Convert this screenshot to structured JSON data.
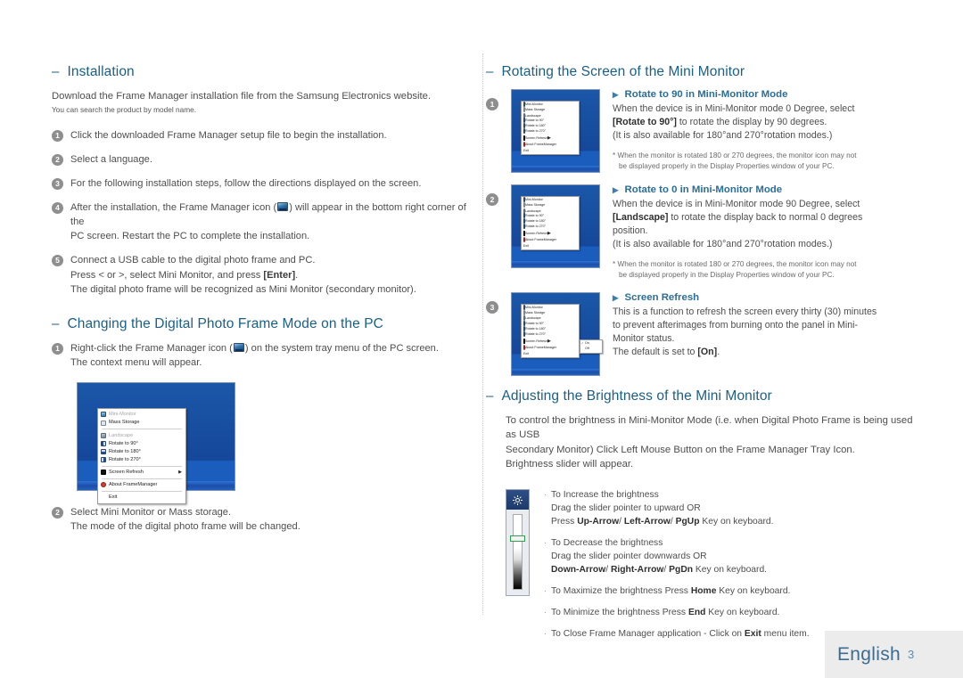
{
  "left": {
    "section1": {
      "heading": "Installation",
      "intro": "Download the Frame Manager installation file from the Samsung Electronics website.",
      "intro_small": "You can search the product by model name.",
      "steps": [
        {
          "num": "1",
          "line1": "Click the downloaded Frame Manager setup file to begin the installation."
        },
        {
          "num": "2",
          "line1": "Select a language."
        },
        {
          "num": "3",
          "line1": "For the following installation steps, follow the directions displayed on the screen."
        },
        {
          "num": "4",
          "pre": "After the installation, the Frame Manager icon (",
          "post": ") will appear in the bottom right corner of the",
          "line2": "PC screen. Restart the PC to complete the installation."
        },
        {
          "num": "5",
          "line1": "Connect a USB cable to the digital photo frame and PC.",
          "line2a": "Press < or >, select Mini Monitor, and press ",
          "line2b": "[Enter]",
          "line2c": ".",
          "line3": "The digital photo frame will be recognized as Mini Monitor (secondary monitor)."
        }
      ]
    },
    "section2": {
      "heading": "Changing the Digital Photo Frame Mode on the PC",
      "step1": {
        "num": "1",
        "pre": "Right-click the Frame Manager icon (",
        "post": ") on the system tray menu of the PC screen.",
        "line2": "The context menu will appear."
      },
      "step2": {
        "num": "2",
        "line1": "Select Mini Monitor or Mass storage.",
        "line2": "The mode of the digital photo frame will be changed."
      }
    },
    "context_menu": {
      "items": [
        {
          "label": "Mini-Monitor",
          "state": "disabled",
          "icon": "monitor-icon"
        },
        {
          "label": "Mass Storage",
          "state": "normal",
          "icon": "mass-storage-icon"
        },
        {
          "label": "Landscape",
          "state": "disabled",
          "icon": "landscape-icon"
        },
        {
          "label": "Rotate to 90°",
          "state": "normal",
          "icon": "rotate-90-icon"
        },
        {
          "label": "Rotate to 180°",
          "state": "normal",
          "icon": "rotate-180-icon"
        },
        {
          "label": "Rotate to 270°",
          "state": "normal",
          "icon": "rotate-270-icon"
        },
        {
          "label": "Screen Refresh",
          "state": "normal",
          "icon": "screen-refresh-icon",
          "submenu": true
        },
        {
          "label": "About FrameManager",
          "state": "normal",
          "icon": "about-icon"
        },
        {
          "label": "Exit",
          "state": "normal",
          "icon": "none"
        }
      ]
    }
  },
  "right": {
    "section1": {
      "heading": "Rotating the Screen of the Mini Monitor",
      "items": [
        {
          "num": "1",
          "title": "Rotate to 90 in Mini-Monitor Mode",
          "l1": "When the device is in Mini-Monitor mode 0 Degree, select",
          "l2a": "[Rotate to 90°]",
          "l2b": " to rotate the display by 90 degrees.",
          "l3": "(It is also available for 180°and 270°rotation modes.)",
          "note1": "* When the monitor is rotated 180 or 270 degrees, the monitor icon may not",
          "note2": "be displayed properly in the Display Properties window of your PC."
        },
        {
          "num": "2",
          "title": "Rotate to 0 in Mini-Monitor Mode",
          "l1": "When the device is in Mini-Monitor mode 90 Degree, select",
          "l2a": "[Landscape]",
          "l2b": " to rotate the display back to normal 0 degrees",
          "l2c": "position.",
          "l3": "(It is also available for 180°and 270°rotation modes.)",
          "note1": "* When the monitor is rotated 180 or 270 degrees, the monitor icon may not",
          "note2": "be displayed properly in the Display Properties window of your PC."
        },
        {
          "num": "3",
          "title": "Screen Refresh",
          "l1": "This is a function to refresh the screen every thirty (30) minutes",
          "l2": "to prevent afterimages from burning onto the panel in Mini-",
          "l3": "Monitor status.",
          "l4a": "The default is set to ",
          "l4b": "[On]",
          "l4c": "."
        }
      ],
      "submenu": {
        "on": "On",
        "off": "Off"
      }
    },
    "section2": {
      "heading": "Adjusting the Brightness of the Mini Monitor",
      "p1": "To control the brightness in Mini-Monitor Mode (i.e. when Digital Photo Frame is being used as USB",
      "p2": "Secondary Monitor) Click Left Mouse Button on the Frame Manager Tray Icon.",
      "p3": "Brightness slider will appear.",
      "bullets": [
        {
          "l1": "To Increase the brightness",
          "l2": "Drag the slider pointer to upward OR",
          "l3a": "Press ",
          "l3b": "Up-Arrow",
          "l3c": "/ ",
          "l3d": "Left-Arrow",
          "l3e": "/ ",
          "l3f": "PgUp",
          "l3g": " Key on keyboard."
        },
        {
          "l1": "To Decrease the brightness",
          "l2": "Drag the slider pointer downwards OR",
          "l3b": "Down-Arrow",
          "l3c": "/ ",
          "l3d": "Right-Arrow",
          "l3e": "/ ",
          "l3f": "PgDn",
          "l3g": " Key on keyboard."
        },
        {
          "l1a": "To Maximize the brightness Press ",
          "l1b": "Home",
          "l1c": " Key on keyboard."
        },
        {
          "l1a": "To Minimize the brightness Press ",
          "l1b": "End",
          "l1c": " Key on keyboard."
        },
        {
          "l1a": "To Close Frame Manager application - Click on ",
          "l1b": "Exit",
          "l1c": " menu item."
        }
      ]
    }
  },
  "footer": {
    "language": "English",
    "page": "3"
  },
  "colors": {
    "heading": "#1a5f86",
    "subheading": "#2c6d96",
    "badge": "#8e8e8e",
    "footer_bg": "#ececec",
    "page_number": "#4f90bf"
  }
}
